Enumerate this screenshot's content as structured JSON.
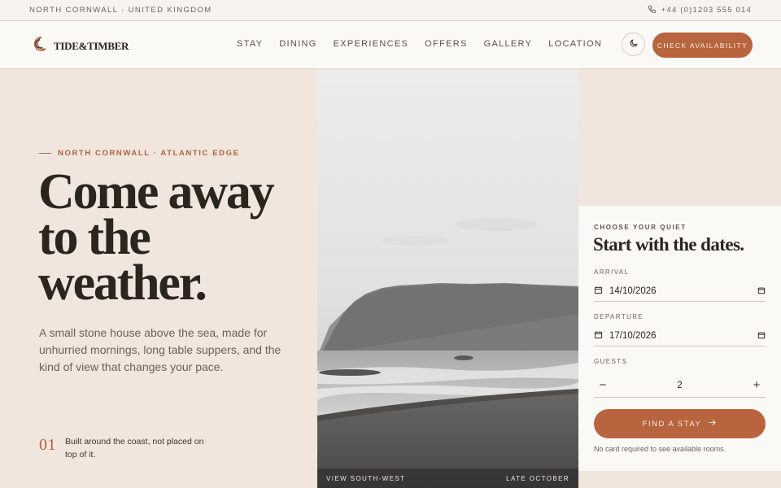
{
  "topbar": {
    "location": "NORTH CORNWALL · UNITED KINGDOM",
    "phone": "+44 (0)1203 555 014",
    "phone_icon": "phone-icon"
  },
  "header": {
    "brand": "TIDE&TIMBER",
    "logo_icon": "crescent-moon-logo-icon",
    "nav": [
      "STAY",
      "DINING",
      "EXPERIENCES",
      "OFFERS",
      "GALLERY",
      "LOCATION"
    ],
    "theme_icon": "moon-icon",
    "cta_label": "CHECK AVAILABILITY",
    "accent_color": "#b8643e"
  },
  "hero": {
    "kicker": "NORTH CORNWALL · ATLANTIC EDGE",
    "headline_lines": [
      "Come away",
      "to the",
      "weather."
    ],
    "lede": "A small stone house above the sea, made for unhurried mornings, long table suppers, and the kind of view that changes your pace.",
    "feature_number": "01",
    "feature_text": "Built around the coast, not placed on top of it."
  },
  "photo": {
    "caption_left": "VIEW SOUTH-WEST",
    "caption_right": "LATE OCTOBER"
  },
  "booking": {
    "eyebrow": "CHOOSE YOUR QUIET",
    "title": "Start with the dates.",
    "arrival_label": "ARRIVAL",
    "arrival_value": "14/10/2026",
    "departure_label": "DEPARTURE",
    "departure_value": "17/10/2026",
    "guests_label": "GUESTS",
    "guests_value": "2",
    "decrement": "−",
    "increment": "+",
    "submit_label": "FIND A STAY",
    "note": "No card required to see available rooms."
  }
}
